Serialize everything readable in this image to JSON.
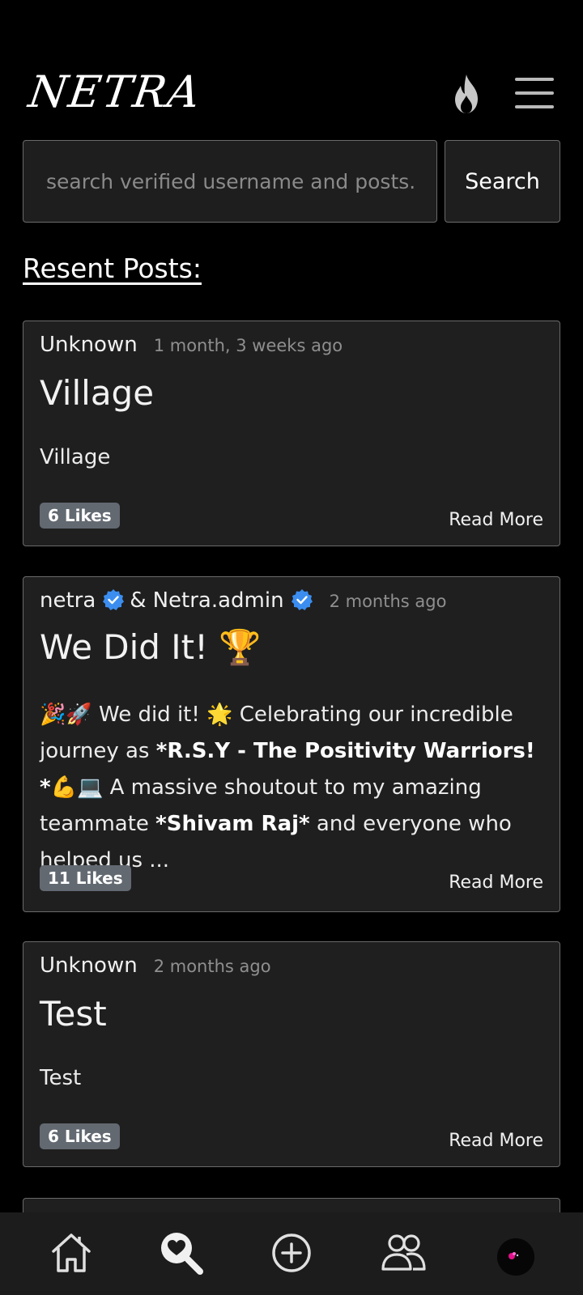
{
  "header": {
    "brand": "NETRA",
    "trending_icon": "flame-icon",
    "menu_icon": "hamburger-menu-icon"
  },
  "search": {
    "placeholder": "search verified username and posts.",
    "value": "",
    "button_label": "Search"
  },
  "section_title": "Resent Posts:",
  "posts": [
    {
      "author": "Unknown",
      "time": "1 month, 3 weeks ago",
      "title": "Village",
      "body": "Village",
      "likes": "6 Likes",
      "read_more": "Read More"
    },
    {
      "author": "netra",
      "coauthor_sep": "&",
      "coauthor": "Netra.admin",
      "time": "2 months ago",
      "title": "We Did It! 🏆",
      "body_line1_pre": "🎉🚀 We did it! 🌟 Celebrating our incredible journey as ",
      "body_bold1": "*R.S.Y - The Positivity Warriors! *",
      "body_mid": "💪💻 A massive shoutout to my amazing teammate ",
      "body_bold2": "*Shivam Raj*",
      "body_end": " and everyone who helped us ...",
      "likes": "11 Likes",
      "read_more": "Read More"
    },
    {
      "author": "Unknown",
      "time": "2 months ago",
      "title": "Test",
      "body": "Test",
      "likes": "6 Likes",
      "read_more": "Read More"
    }
  ],
  "nav": {
    "items": [
      "home-icon",
      "explore-search-icon",
      "create-post-icon",
      "friends-icon",
      "profile-avatar"
    ]
  },
  "colors": {
    "background": "#000000",
    "card": "#1f1f1f",
    "border": "#6a6a6a",
    "likes_badge": "#636971",
    "verified": "#3b8ef0"
  }
}
